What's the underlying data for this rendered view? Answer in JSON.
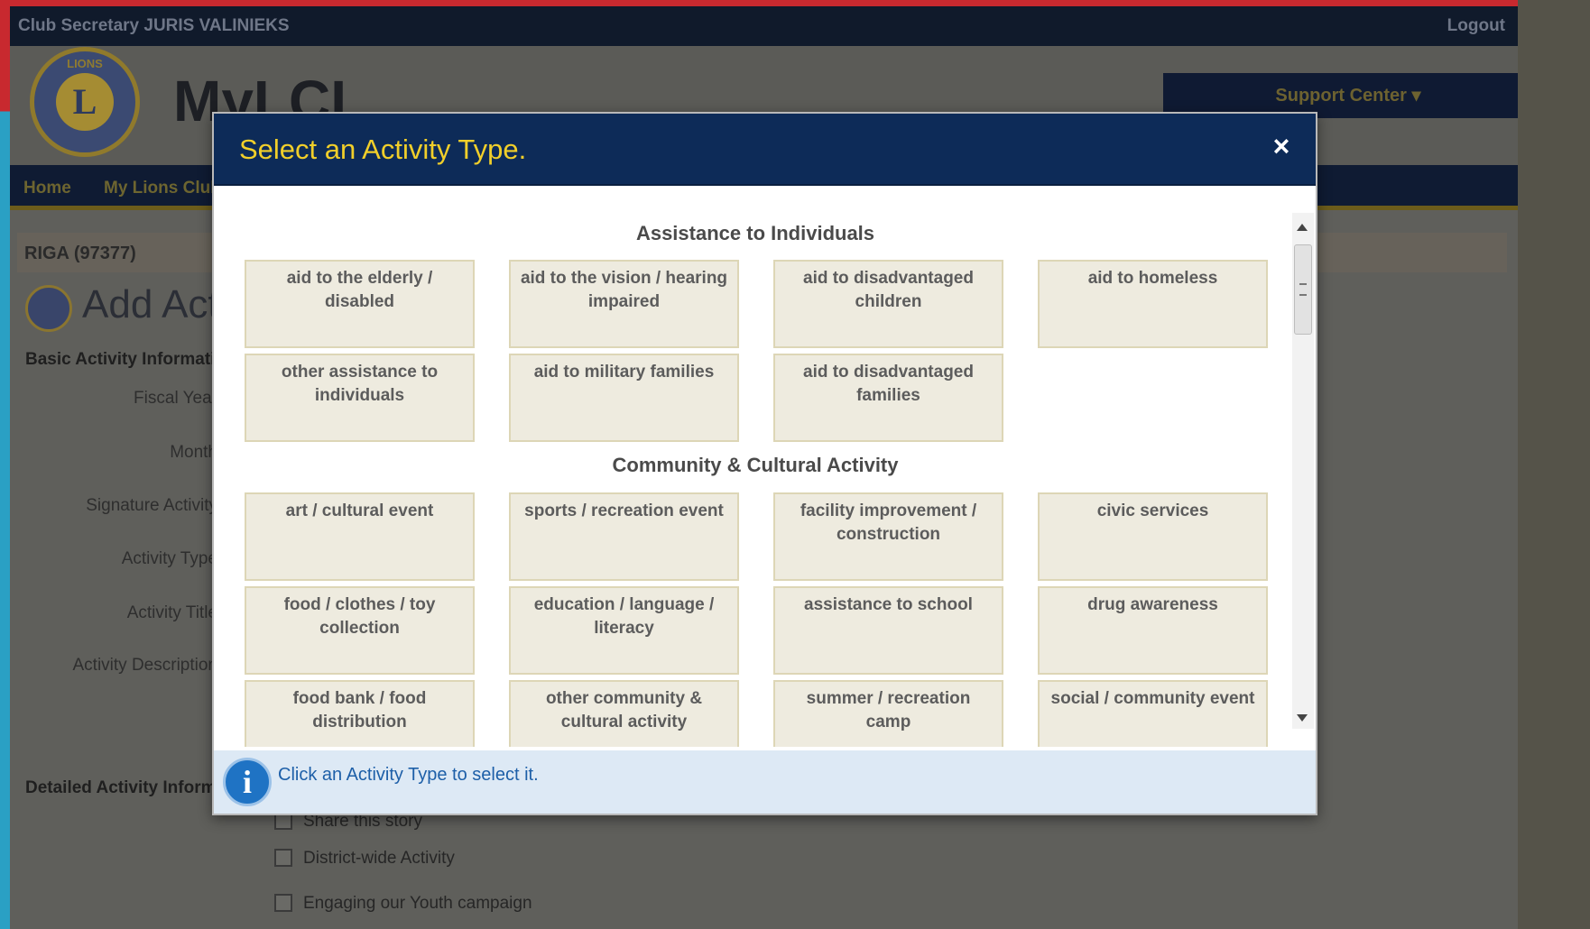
{
  "topbar": {
    "user": "Club Secretary JURIS VALINIEKS",
    "logout": "Logout"
  },
  "header": {
    "brand": "MyLCI",
    "logo_text": "LIONS",
    "logo_letter": "L",
    "support": "Support Center"
  },
  "nav": {
    "home": "Home",
    "my_lions_club": "My Lions Club"
  },
  "breadcrumb": "RIGA (97377)",
  "page": {
    "title": "Add Activity"
  },
  "form": {
    "basic_section": "Basic Activity Information",
    "labels": [
      "Fiscal Year",
      "Month",
      "Signature Activity",
      "Activity Type",
      "Activity Title",
      "Activity Description"
    ],
    "detailed_section": "Detailed Activity Information",
    "checks": [
      "Share this story",
      "District-wide Activity",
      "Engaging our Youth campaign"
    ]
  },
  "modal": {
    "title": "Select an Activity Type.",
    "close": "×",
    "categories": [
      {
        "title": "Assistance to Individuals",
        "items": [
          "aid to the elderly / disabled",
          "aid to the vision / hearing impaired",
          "aid to disadvantaged children",
          "aid to homeless",
          "other assistance to individuals",
          "aid to military families",
          "aid to disadvantaged families"
        ]
      },
      {
        "title": "Community & Cultural Activity",
        "items": [
          "art / cultural event",
          "sports / recreation event",
          "facility improvement / construction",
          "civic services",
          "food / clothes / toy collection",
          "education / language / literacy",
          "assistance to school",
          "drug awareness",
          "food bank / food distribution",
          "other community & cultural activity",
          "summer / recreation camp",
          "social / community event"
        ]
      }
    ],
    "footer_text": "Click an Activity Type to select it.",
    "info_glyph": "i"
  },
  "colors": {
    "modal_header": "#0d2b58",
    "modal_title": "#f1cf2a",
    "tile_bg": "#eeebdf",
    "footer_bg": "#dde9f5"
  }
}
